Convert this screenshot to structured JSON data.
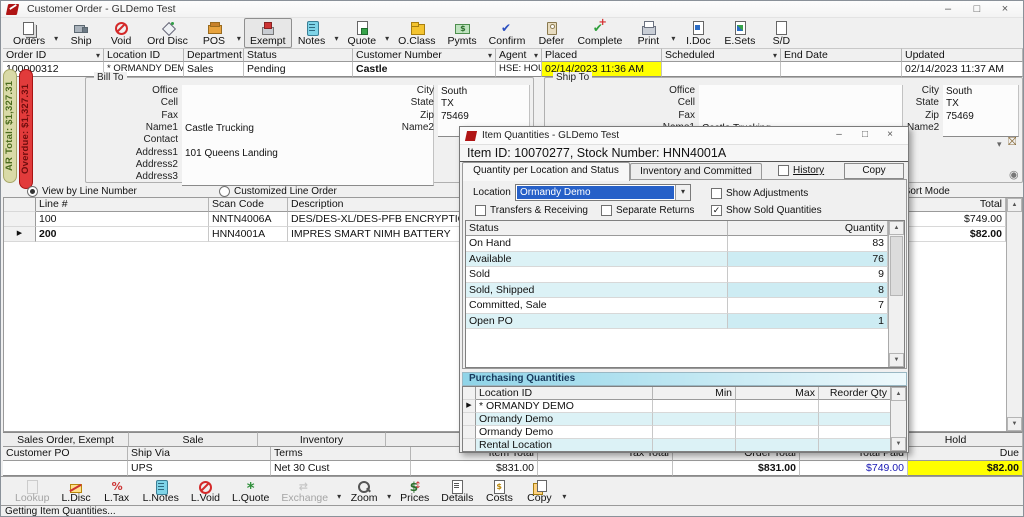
{
  "window": {
    "title": "Customer Order - GLDemo Test",
    "controls": {
      "minimize": "–",
      "maximize": "□",
      "close": "×"
    }
  },
  "toolbar_top": {
    "buttons": [
      {
        "label": "Orders",
        "icon": "orders",
        "dropdown": true
      },
      {
        "label": "Ship",
        "icon": "ship"
      },
      {
        "label": "Void",
        "icon": "void"
      },
      {
        "label": "Ord Disc",
        "icon": "discount"
      },
      {
        "label": "POS",
        "icon": "pos",
        "dropdown": true
      },
      {
        "label": "Exempt",
        "icon": "exempt",
        "pressed": true
      },
      {
        "label": "Notes",
        "icon": "notes",
        "dropdown": true
      },
      {
        "label": "Quote",
        "icon": "quote",
        "dropdown": true
      },
      {
        "label": "O.Class",
        "icon": "oclass"
      },
      {
        "label": "Pymts",
        "icon": "pymts"
      },
      {
        "label": "Confirm",
        "icon": "confirm"
      },
      {
        "label": "Defer",
        "icon": "defer"
      },
      {
        "label": "Complete",
        "icon": "complete"
      },
      {
        "label": "Print",
        "icon": "print",
        "dropdown": true
      },
      {
        "label": "I.Doc",
        "icon": "idoc"
      },
      {
        "label": "E.Sets",
        "icon": "esets"
      },
      {
        "label": "S/D",
        "icon": "sd"
      }
    ]
  },
  "order_header": {
    "columns": [
      {
        "label": "Order ID",
        "dropdown": true
      },
      {
        "label": "Location ID"
      },
      {
        "label": "Department"
      },
      {
        "label": "Status"
      },
      {
        "label": "Customer Number",
        "dropdown": true
      },
      {
        "label": "Agent",
        "dropdown": true
      },
      {
        "label": "Placed"
      },
      {
        "label": "Scheduled",
        "dropdown": true
      },
      {
        "label": "End Date"
      },
      {
        "label": "Updated"
      }
    ],
    "values": [
      {
        "text": "100000312"
      },
      {
        "text": "* ORMANDY DEMO",
        "small": true
      },
      {
        "text": "Sales"
      },
      {
        "text": "Pending"
      },
      {
        "text": "Castle",
        "bold": true
      },
      {
        "text": "HSE: HOUSE",
        "small": true
      },
      {
        "text": "02/14/2023 11:36 AM",
        "highlight": true
      },
      {
        "text": ""
      },
      {
        "text": ""
      },
      {
        "text": "02/14/2023 11:37 AM"
      }
    ]
  },
  "ar_badges": {
    "ar_total": "AR Total: $1,327.31",
    "overdue": "Overdue: $1,327.31"
  },
  "bill_to": {
    "title": "Bill To",
    "fields": [
      {
        "label": "Office",
        "value": ""
      },
      {
        "label": "Cell",
        "value": ""
      },
      {
        "label": "Fax",
        "value": ""
      },
      {
        "label": "Name1",
        "value": "Castle Trucking"
      },
      {
        "label": "Contact",
        "value": ""
      },
      {
        "label": "Address1",
        "value": "101 Queens Landing"
      },
      {
        "label": "Address2",
        "value": ""
      },
      {
        "label": "Address3",
        "value": ""
      }
    ],
    "right_fields": [
      {
        "label": "City",
        "value": "South"
      },
      {
        "label": "State",
        "value": "TX"
      },
      {
        "label": "Zip",
        "value": "75469"
      },
      {
        "label": "Name2",
        "value": ""
      }
    ]
  },
  "ship_to": {
    "title": "Ship To",
    "fields": [
      {
        "label": "Office",
        "value": ""
      },
      {
        "label": "Cell",
        "value": ""
      },
      {
        "label": "Fax",
        "value": ""
      },
      {
        "label": "Name1",
        "value": "Castle Trucking"
      },
      {
        "label": "Contact",
        "value": ""
      },
      {
        "label": "Address1",
        "value": ""
      },
      {
        "label": "Address2",
        "value": ""
      },
      {
        "label": "Address3",
        "value": ""
      }
    ],
    "right_fields": [
      {
        "label": "City",
        "value": "South"
      },
      {
        "label": "State",
        "value": "TX"
      },
      {
        "label": "Zip",
        "value": "75469"
      },
      {
        "label": "Name2",
        "value": ""
      }
    ]
  },
  "view_options": {
    "option1": "View by Line Number",
    "option2": "Customized Line Order",
    "fragment": "e",
    "option3": "Line Sort Mode"
  },
  "line_items": {
    "columns": [
      "Line #",
      "Scan Code",
      "Description",
      "Total"
    ],
    "rows": [
      {
        "line": "100",
        "scan": "NNTN4006A",
        "desc": "DES/DES-XL/DES-PFB ENCRYPTION KIT-",
        "total": "$749.00",
        "current": false,
        "bold": false
      },
      {
        "line": "200",
        "scan": "HNN4001A",
        "desc": "IMPRES SMART NIMH BATTERY",
        "total": "$82.00",
        "current": true,
        "bold": true
      }
    ]
  },
  "dialog": {
    "title": "Item Quantities - GLDemo Test",
    "item_header": "Item ID: 10070277, Stock Number: HNN4001A",
    "tab1": "Quantity per Location and Status",
    "tab2": "Inventory and Committed",
    "history_label": "History",
    "copy_button": "Copy",
    "location_label": "Location",
    "location_value": "Ormandy Demo",
    "checkboxes": {
      "show_adjustments": {
        "label": "Show Adjustments",
        "checked": false
      },
      "transfers": {
        "label": "Transfers & Receiving",
        "checked": false
      },
      "separate_returns": {
        "label": "Separate Returns",
        "checked": false
      },
      "show_sold": {
        "label": "Show Sold Quantities",
        "checked": true
      }
    },
    "status_table": {
      "columns": [
        "Status",
        "Quantity"
      ],
      "rows": [
        {
          "status": "On Hand",
          "quantity": "83"
        },
        {
          "status": "Available",
          "quantity": "76"
        },
        {
          "status": "Sold",
          "quantity": "9"
        },
        {
          "status": "Sold, Shipped",
          "quantity": "8"
        },
        {
          "status": "Committed, Sale",
          "quantity": "7"
        },
        {
          "status": "Open PO",
          "quantity": "1"
        }
      ]
    },
    "purchasing": {
      "title": "Purchasing Quantities",
      "columns": [
        "Location ID",
        "Min",
        "Max",
        "Reorder Qty"
      ],
      "rows": [
        {
          "location": "* ORMANDY DEMO",
          "min": "",
          "max": "",
          "reorder": "",
          "current": true
        },
        {
          "location": "Ormandy Demo",
          "min": "",
          "max": "",
          "reorder": "",
          "current": false
        },
        {
          "location": "Ormandy Demo",
          "min": "",
          "max": "",
          "reorder": "",
          "current": false
        },
        {
          "location": "Rental Location",
          "min": "",
          "max": "",
          "reorder": "",
          "current": false
        }
      ]
    }
  },
  "footer": {
    "sections": [
      "Sales Order, Exempt",
      "Sale",
      "Inventory",
      "",
      "Hold"
    ],
    "columns": [
      "Customer PO",
      "Ship Via",
      "Terms",
      "Item Total",
      "Tax Total",
      "Order Total",
      "Total Paid",
      "Due"
    ],
    "values": [
      {
        "text": ""
      },
      {
        "text": "UPS"
      },
      {
        "text": "Net 30 Cust"
      },
      {
        "text": "$831.00"
      },
      {
        "text": ""
      },
      {
        "text": "$831.00",
        "bold": true
      },
      {
        "text": "$749.00",
        "blue": true
      },
      {
        "text": "$82.00",
        "bold": true,
        "highlight": true
      }
    ]
  },
  "toolbar_bottom": {
    "buttons": [
      {
        "label": "Lookup",
        "icon": "lookup",
        "disabled": true
      },
      {
        "label": "L.Disc",
        "icon": "ldisc"
      },
      {
        "label": "L.Tax",
        "icon": "ltax"
      },
      {
        "label": "L.Notes",
        "icon": "lnotes"
      },
      {
        "label": "L.Void",
        "icon": "lvoid"
      },
      {
        "label": "L.Quote",
        "icon": "lquote"
      },
      {
        "label": "Exchange",
        "icon": "exchange",
        "disabled": true,
        "dropdown": true
      },
      {
        "label": "Zoom",
        "icon": "zoom",
        "dropdown": true
      },
      {
        "label": "Prices",
        "icon": "prices"
      },
      {
        "label": "Details",
        "icon": "details"
      },
      {
        "label": "Costs",
        "icon": "costs"
      },
      {
        "label": "Copy",
        "icon": "copy",
        "dropdown": true
      }
    ]
  },
  "status_bar": {
    "text": "Getting Item Quantities..."
  }
}
